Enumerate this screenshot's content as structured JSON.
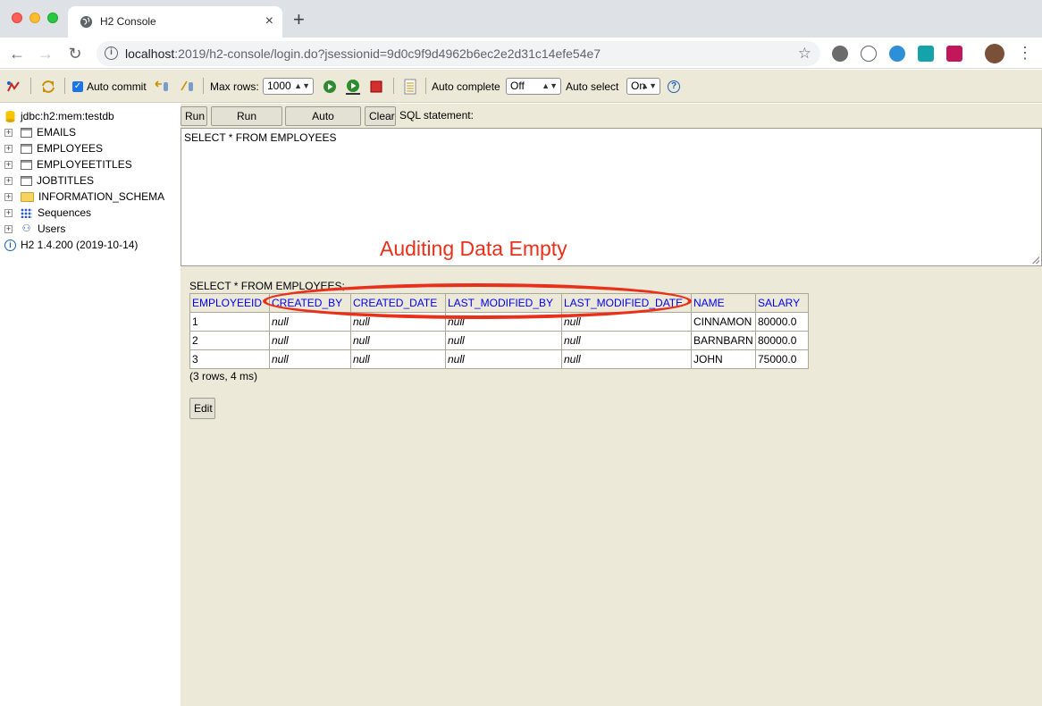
{
  "browser": {
    "tab_title": "H2 Console",
    "tab_close": "×",
    "new_tab": "+",
    "url_host": "localhost",
    "url_rest": ":2019/h2-console/login.do?jsessionid=9d0c9f9d4962b6ec2e2d31c14efe54e7",
    "back": "←",
    "forward": "→",
    "reload": "↻",
    "star": "☆",
    "menu": "⋮"
  },
  "h2toolbar": {
    "auto_commit_label": "Auto commit",
    "max_rows_label": "Max rows:",
    "max_rows_value": "1000",
    "auto_complete_label": "Auto complete",
    "auto_complete_value": "Off",
    "auto_select_label": "Auto select",
    "auto_select_value": "On",
    "help": "?"
  },
  "tree": {
    "connection": "jdbc:h2:mem:testdb",
    "tables": [
      "EMAILS",
      "EMPLOYEES",
      "EMPLOYEETITLES",
      "JOBTITLES"
    ],
    "schema": "INFORMATION_SCHEMA",
    "sequences": "Sequences",
    "users": "Users",
    "version": "H2 1.4.200 (2019-10-14)"
  },
  "editor": {
    "run": "Run",
    "run_selected": "Run Selected",
    "auto_complete": "Auto complete",
    "clear": "Clear",
    "sql_label": "SQL statement:",
    "sql_text": "SELECT * FROM EMPLOYEES",
    "annotation": "Auditing Data Empty"
  },
  "result": {
    "statement": "SELECT * FROM EMPLOYEES;",
    "columns": [
      "EMPLOYEEID",
      "CREATED_BY",
      "CREATED_DATE",
      "LAST_MODIFIED_BY",
      "LAST_MODIFIED_DATE",
      "NAME",
      "SALARY"
    ],
    "rows": [
      [
        "1",
        "null",
        "null",
        "null",
        "null",
        "CINNAMON",
        "80000.0"
      ],
      [
        "2",
        "null",
        "null",
        "null",
        "null",
        "BARNBARN",
        "80000.0"
      ],
      [
        "3",
        "null",
        "null",
        "null",
        "null",
        "JOHN",
        "75000.0"
      ]
    ],
    "summary": "(3 rows, 4 ms)",
    "edit": "Edit"
  },
  "colors": {
    "annotation": "#e8301b",
    "header_link": "#0000ee",
    "pane_bg": "#ece9d8"
  }
}
